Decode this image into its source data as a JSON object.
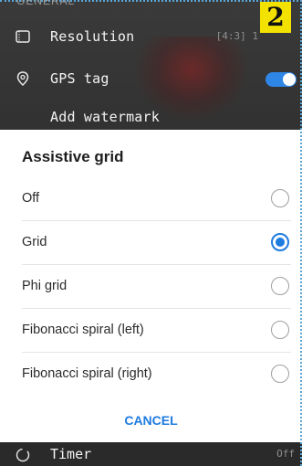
{
  "background": {
    "section_label": "GENERAL",
    "rows": [
      {
        "label": "Resolution",
        "value": "[4:3] 1",
        "icon": "resolution-icon"
      },
      {
        "label": "GPS tag",
        "icon": "location-pin-icon",
        "toggle_on": true
      },
      {
        "label": "Add watermark",
        "icon": "watermark-icon"
      }
    ],
    "timer": {
      "label": "Timer",
      "value": "Off",
      "icon": "timer-icon"
    }
  },
  "badge": "2",
  "dialog": {
    "title": "Assistive grid",
    "options": [
      {
        "label": "Off",
        "selected": false
      },
      {
        "label": "Grid",
        "selected": true
      },
      {
        "label": "Phi grid",
        "selected": false
      },
      {
        "label": "Fibonacci spiral (left)",
        "selected": false
      },
      {
        "label": "Fibonacci spiral (right)",
        "selected": false
      }
    ],
    "cancel_label": "CANCEL"
  },
  "colors": {
    "accent": "#1e7be0",
    "toggle": "#2e86e6",
    "badge": "#f3e200"
  }
}
